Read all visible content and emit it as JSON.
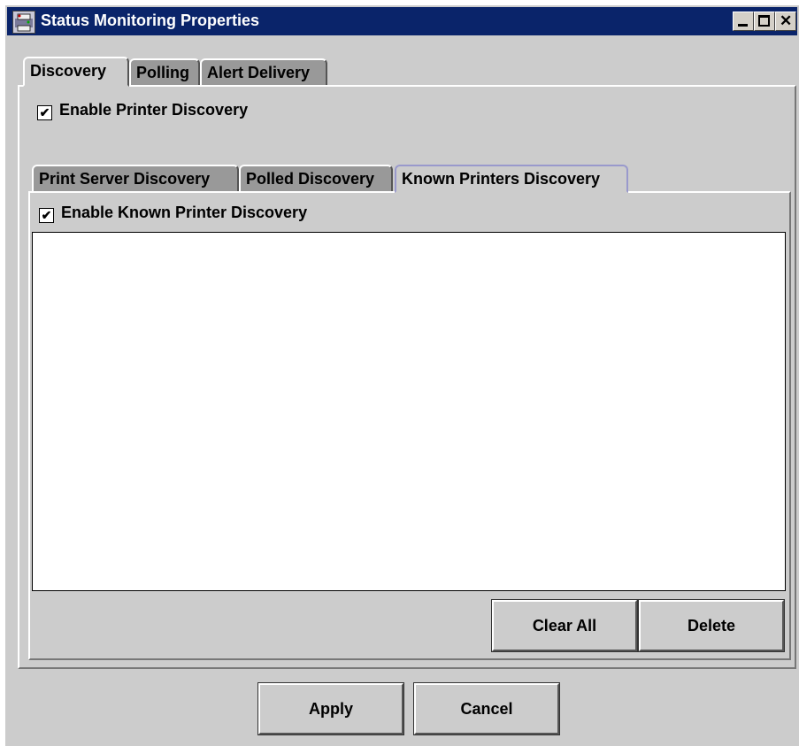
{
  "window": {
    "title": "Status Monitoring Properties"
  },
  "main_tabs": {
    "discovery": "Discovery",
    "polling": "Polling",
    "alert_delivery": "Alert Delivery"
  },
  "discovery": {
    "enable_printer_discovery": "Enable Printer Discovery",
    "checked_mark": "✔"
  },
  "sub_tabs": {
    "print_server": "Print Server Discovery",
    "polled": "Polled Discovery",
    "known_printers": "Known Printers Discovery"
  },
  "known_printers": {
    "enable_known_printer_discovery": "Enable Known Printer Discovery",
    "printer_list": [],
    "clear_all_label": "Clear All",
    "delete_label": "Delete"
  },
  "footer": {
    "apply_label": "Apply",
    "cancel_label": "Cancel"
  }
}
